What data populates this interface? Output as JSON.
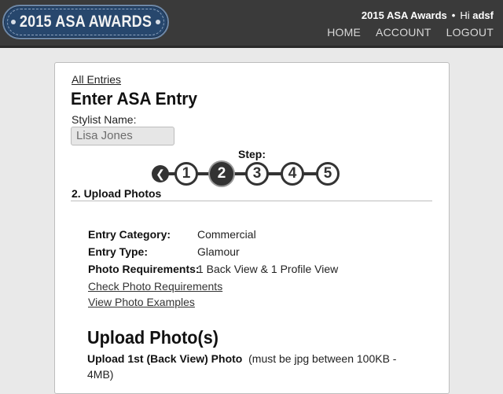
{
  "header": {
    "logo_text": "2015 ASA AWARDS",
    "site_name": "2015 ASA Awards",
    "separator": "•",
    "greeting": "Hi",
    "username": "adsf",
    "nav": [
      "HOME",
      "ACCOUNT",
      "LOGOUT"
    ]
  },
  "main": {
    "all_entries_link": "All Entries",
    "title": "Enter ASA Entry",
    "stylist_label": "Stylist Name:",
    "stylist_value": "Lisa Jones",
    "step_label": "Step:",
    "back_icon": "left-arrow-icon",
    "steps": [
      "1",
      "2",
      "3",
      "4",
      "5"
    ],
    "active_step": 2,
    "section_title": "2. Upload Photos",
    "info": [
      {
        "label": "Entry Category:",
        "value": "Commercial"
      },
      {
        "label": "Entry Type:",
        "value": "Glamour"
      },
      {
        "label": "Photo Requirements:",
        "value": "1 Back View & 1 Profile View"
      }
    ],
    "links": [
      "Check Photo Requirements",
      "View Photo Examples"
    ],
    "upload_heading": "Upload Photo(s)",
    "upload_label_bold": "Upload 1st (Back View) Photo",
    "upload_label_note": "(must be jpg between 100KB - 4MB)"
  },
  "colors": {
    "header_bg": "#3a3a3a",
    "logo_bg": "#27476d",
    "step_dark": "#333333"
  }
}
